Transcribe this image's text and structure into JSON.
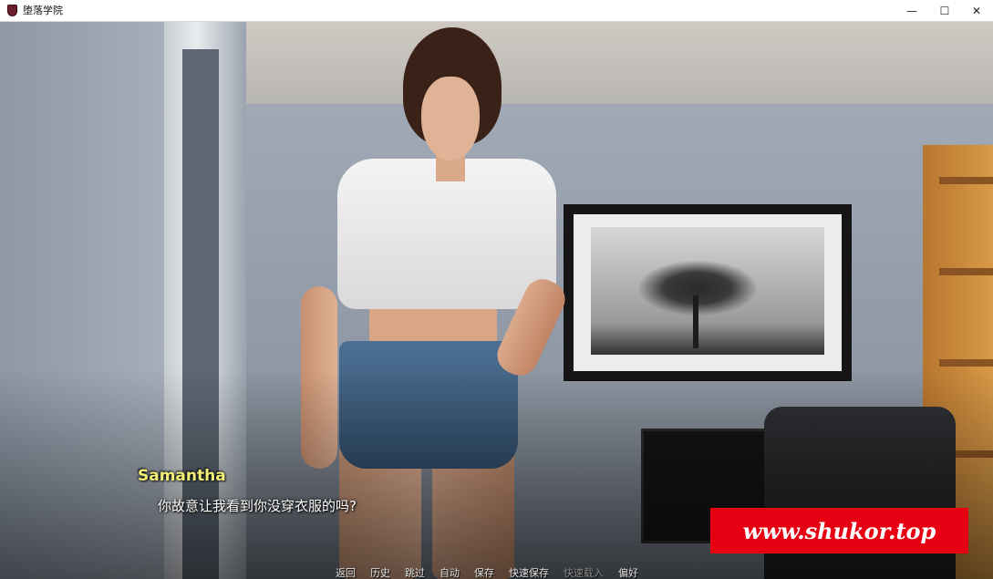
{
  "window": {
    "title": "堕落学院",
    "minimize_glyph": "—",
    "maximize_glyph": "☐",
    "close_glyph": "✕"
  },
  "dialogue": {
    "speaker": "Samantha",
    "text": "你故意让我看到你没穿衣服的吗?",
    "speaker_color": "#f3f07a"
  },
  "watermark": {
    "text": "www.shukor.top",
    "background": "#e60012"
  },
  "quick_menu": [
    {
      "label": "返回",
      "enabled": true
    },
    {
      "label": "历史",
      "enabled": true
    },
    {
      "label": "跳过",
      "enabled": true
    },
    {
      "label": "自动",
      "enabled": true
    },
    {
      "label": "保存",
      "enabled": true
    },
    {
      "label": "快速保存",
      "enabled": true
    },
    {
      "label": "快速载入",
      "enabled": false
    },
    {
      "label": "偏好",
      "enabled": true
    }
  ]
}
